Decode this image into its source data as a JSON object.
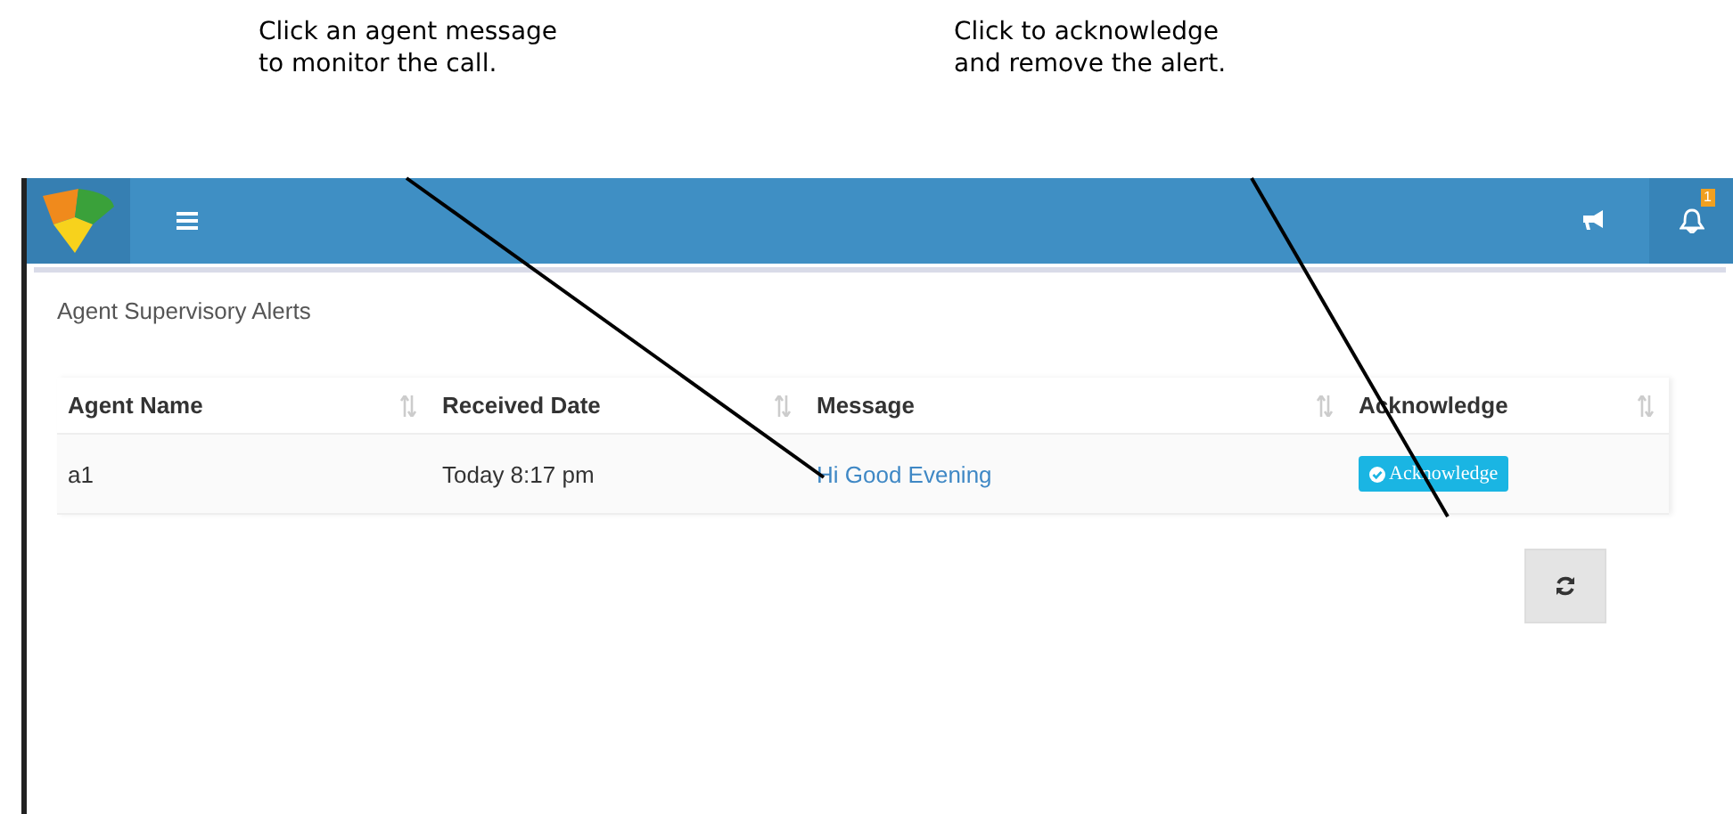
{
  "callouts": [
    {
      "lines": [
        "Click an agent message",
        "to monitor the call."
      ]
    },
    {
      "lines": [
        "Click to acknowledge",
        "and remove the alert."
      ]
    }
  ],
  "header": {
    "notification_count": "1"
  },
  "panel": {
    "title": "Agent Supervisory Alerts"
  },
  "table": {
    "columns": [
      "Agent Name",
      "Received Date",
      "Message",
      "Acknowledge"
    ],
    "rows": [
      {
        "agent_name": "a1",
        "received_date": "Today 8:17 pm",
        "message": "Hi Good Evening",
        "action": "Acknowledge"
      }
    ]
  }
}
